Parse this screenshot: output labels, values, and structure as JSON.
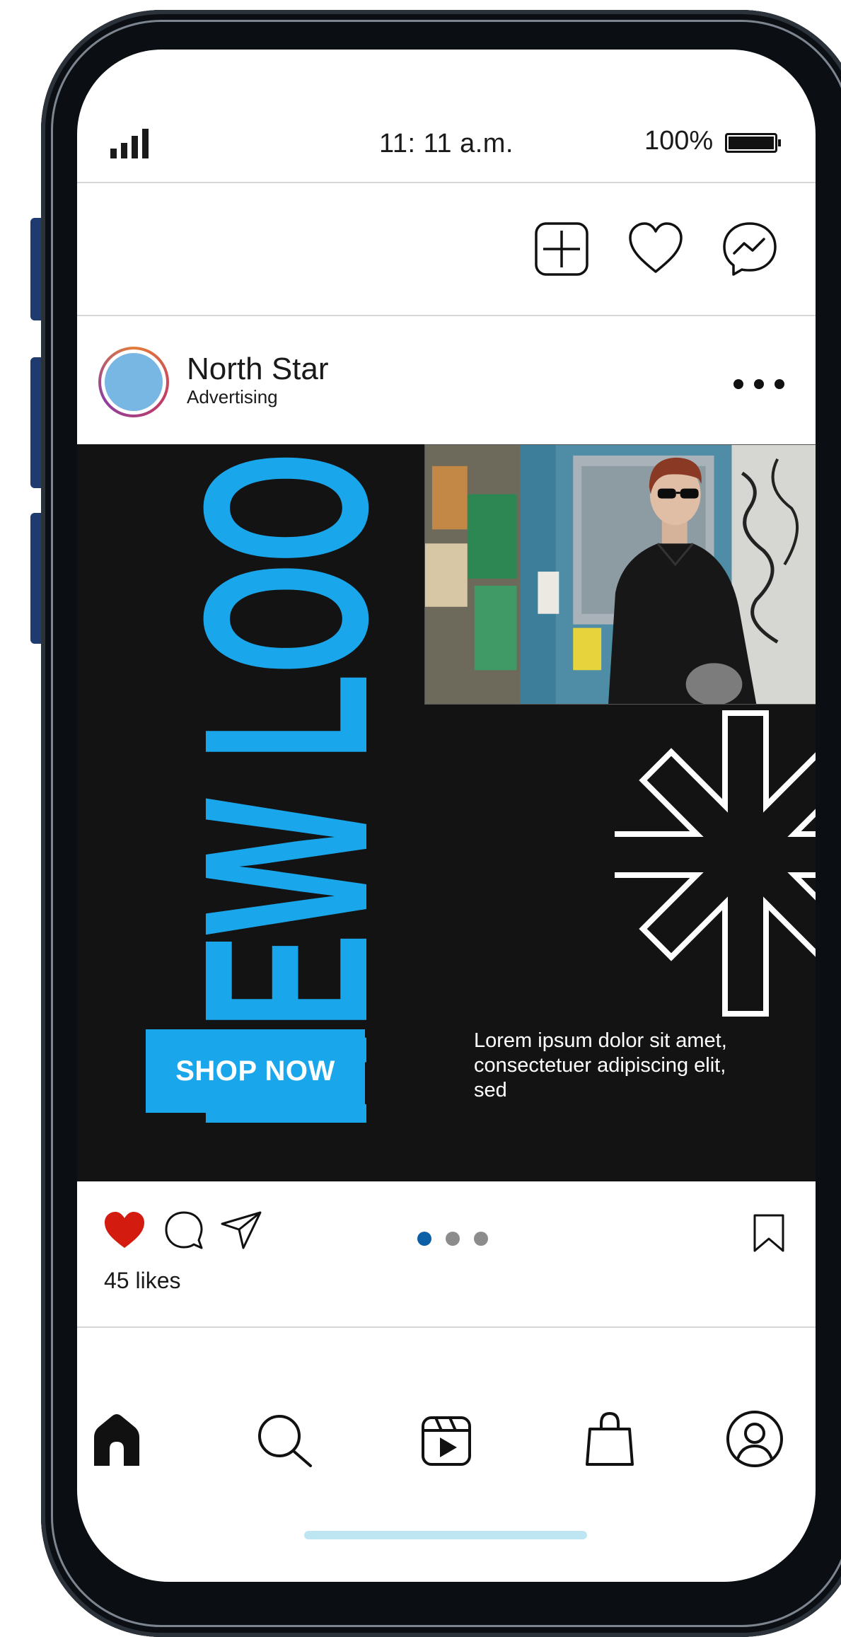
{
  "status_bar": {
    "time": "11: 11 a.m.",
    "battery_percent": "100%",
    "signal_icon": "signal-bars-icon",
    "battery_icon": "battery-full-icon"
  },
  "top_bar": {
    "icons": [
      "add-post-icon",
      "heart-icon",
      "messenger-icon"
    ]
  },
  "profile": {
    "name": "North Star",
    "subtitle": "Advertising",
    "more_icon": "more-options-icon"
  },
  "post": {
    "headline": "NEW LOOK",
    "cta_label": "SHOP NOW",
    "body_text": "Lorem ipsum dolor sit amet, consectetuer adipiscing elit, sed",
    "accent_color": "#1aa6ea",
    "background_color": "#131313",
    "carousel": {
      "slides": 3,
      "active_index": 0
    }
  },
  "actions": {
    "liked": true,
    "likes_text": "45 likes",
    "like_color": "#d31b0f"
  },
  "bottom_nav": {
    "items": [
      "home-icon",
      "search-icon",
      "reels-icon",
      "shop-icon",
      "profile-icon"
    ]
  }
}
